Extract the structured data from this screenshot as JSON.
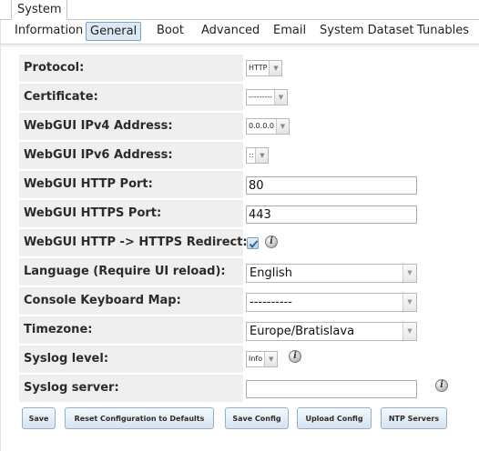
{
  "window_tab": {
    "label": "System"
  },
  "tabs": [
    {
      "label": "Information",
      "active": false
    },
    {
      "label": "General",
      "active": true
    },
    {
      "label": "Boot",
      "active": false
    },
    {
      "label": "Advanced",
      "active": false
    },
    {
      "label": "Email",
      "active": false
    },
    {
      "label": "System Dataset",
      "active": false
    },
    {
      "label": "Tunables",
      "active": false
    }
  ],
  "form": {
    "protocol": {
      "label": "Protocol:",
      "value": "HTTP"
    },
    "certificate": {
      "label": "Certificate:",
      "value": "---------"
    },
    "ipv4": {
      "label": "WebGUI IPv4 Address:",
      "value": "0.0.0.0"
    },
    "ipv6": {
      "label": "WebGUI IPv6 Address:",
      "value": "::"
    },
    "http_port": {
      "label": "WebGUI HTTP Port:",
      "value": "80"
    },
    "https_port": {
      "label": "WebGUI HTTPS Port:",
      "value": "443"
    },
    "redirect": {
      "label": "WebGUI HTTP -> HTTPS Redirect:",
      "checked": true
    },
    "language": {
      "label": "Language (Require UI reload):",
      "value": "English"
    },
    "keyboard": {
      "label": "Console Keyboard Map:",
      "value": "----------"
    },
    "timezone": {
      "label": "Timezone:",
      "value": "Europe/Bratislava"
    },
    "syslog_level": {
      "label": "Syslog level:",
      "value": "Info"
    },
    "syslog_server": {
      "label": "Syslog server:",
      "value": ""
    }
  },
  "buttons": {
    "save": "Save",
    "reset": "Reset Configuration to Defaults",
    "save_config": "Save Config",
    "upload_config": "Upload Config",
    "ntp": "NTP Servers"
  },
  "info_icon_glyph": "i",
  "colors": {
    "active_tab_bg": "#dce8f3",
    "label_bg": "#efefef",
    "button_border": "#8fb0d0"
  }
}
